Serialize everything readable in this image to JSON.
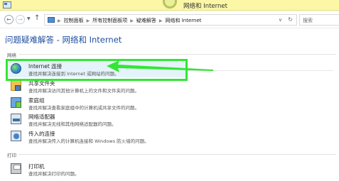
{
  "window": {
    "title": "网络和 Internet"
  },
  "address_bar": {
    "breadcrumbs": [
      "控制面板",
      "所有控制面板项",
      "疑难解答",
      "网络和 Internet"
    ],
    "search_placeholder": "搜索"
  },
  "page": {
    "heading": "问题疑难解答 - 网络和 Internet",
    "groups": [
      {
        "label": "网络",
        "items": [
          {
            "title": "Internet 连接",
            "desc": "查找并解决连接到 Internet 或网站的问题。",
            "icon": "globe-icon"
          },
          {
            "title": "共享文件夹",
            "desc": "查找并解决访问其他计算机上的文件和文件夹的问题。",
            "icon": "shared-folder-icon"
          },
          {
            "title": "家庭组",
            "desc": "查找并解决查看家庭组中的计算机或共享文件的问题。",
            "icon": "homegroup-icon"
          },
          {
            "title": "网络适配器",
            "desc": "查找并解决无线和其他网络适配器的问题。",
            "icon": "network-adapter-icon"
          },
          {
            "title": "传入的连接",
            "desc": "查找并解决传入的计算机连接和 Windows 防火墙的问题。",
            "icon": "incoming-connections-icon"
          }
        ]
      },
      {
        "label": "打印",
        "items": [
          {
            "title": "打印机",
            "desc": "查找并解决打印的问题。",
            "icon": "printer-icon"
          }
        ]
      }
    ]
  },
  "annotation": {
    "color": "#33e633"
  }
}
